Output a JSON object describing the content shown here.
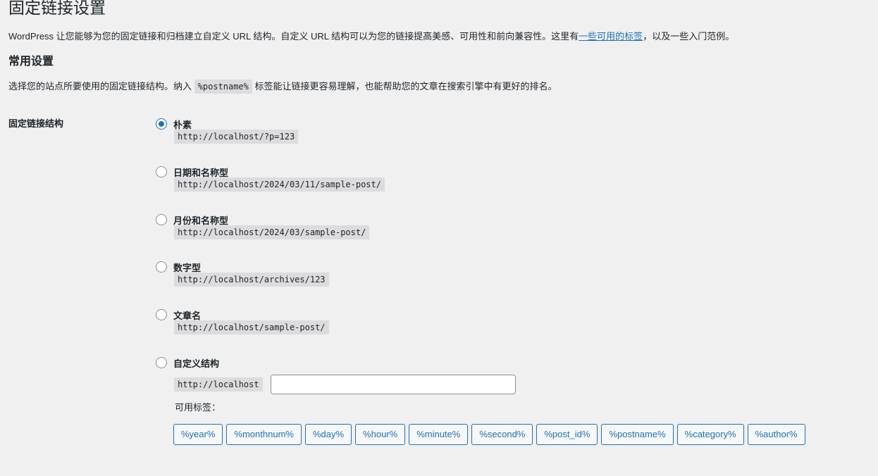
{
  "page": {
    "title": "固定链接设置",
    "intro_prefix": "WordPress 让您能够为您的固定链接和归档建立自定义 URL 结构。自定义 URL 结构可以为您的链接提高美感、可用性和前向兼容性。这里有",
    "intro_link": "一些可用的标签",
    "intro_suffix": "，以及一些入门范例。"
  },
  "common": {
    "title": "常用设置",
    "desc_prefix": "选择您的站点所要使用的固定链接结构。纳入 ",
    "desc_code": "%postname%",
    "desc_suffix": " 标签能让链接更容易理解，也能帮助您的文章在搜索引擎中有更好的排名。",
    "field_label": "固定链接结构"
  },
  "options": [
    {
      "label": "朴素",
      "example": "http://localhost/?p=123",
      "checked": true
    },
    {
      "label": "日期和名称型",
      "example": "http://localhost/2024/03/11/sample-post/",
      "checked": false
    },
    {
      "label": "月份和名称型",
      "example": "http://localhost/2024/03/sample-post/",
      "checked": false
    },
    {
      "label": "数字型",
      "example": "http://localhost/archives/123",
      "checked": false
    },
    {
      "label": "文章名",
      "example": "http://localhost/sample-post/",
      "checked": false
    },
    {
      "label": "自定义结构",
      "checked": false
    }
  ],
  "custom": {
    "base": "http://localhost",
    "value": "",
    "tags_label": "可用标签：",
    "tags": [
      "%year%",
      "%monthnum%",
      "%day%",
      "%hour%",
      "%minute%",
      "%second%",
      "%post_id%",
      "%postname%",
      "%category%",
      "%author%"
    ]
  },
  "colors": {
    "background": "#f0f0f1",
    "accent": "#2271b1",
    "text": "#1d2327",
    "code_bg": "#dcdcde"
  }
}
